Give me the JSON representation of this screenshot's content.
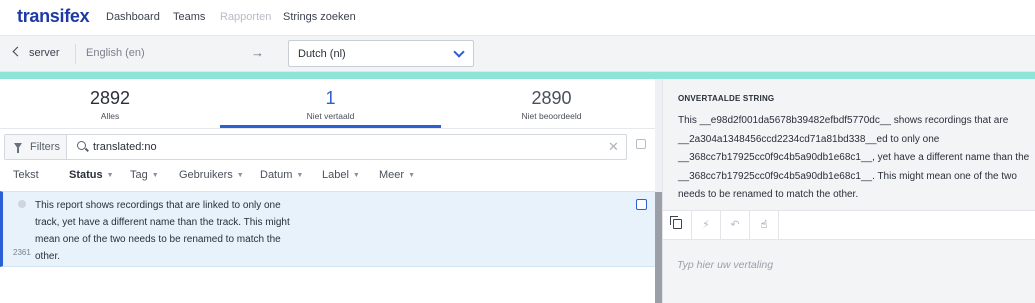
{
  "app": {
    "logo": "transifex"
  },
  "nav": {
    "items": [
      {
        "label": "Dashboard",
        "enabled": true
      },
      {
        "label": "Teams",
        "enabled": true
      },
      {
        "label": "Rapporten",
        "enabled": false
      },
      {
        "label": "Strings zoeken",
        "enabled": true
      }
    ]
  },
  "subbar": {
    "back_label": "server",
    "source_language": "English (en)",
    "arrow": "→",
    "target_language": "Dutch (nl)"
  },
  "stats": [
    {
      "count": "2892",
      "label": "Alles"
    },
    {
      "count": "1",
      "label": "Niet vertaald"
    },
    {
      "count": "2890",
      "label": "Niet beoordeeld"
    }
  ],
  "filters": {
    "button_label": "Filters",
    "query": "translated:no",
    "clear_glyph": "✕",
    "tabs": [
      {
        "label": "Tekst",
        "bold": false,
        "dropdown": false
      },
      {
        "label": "Status",
        "bold": true,
        "dropdown": true
      },
      {
        "label": "Tag",
        "bold": false,
        "dropdown": true
      },
      {
        "label": "Gebruikers",
        "bold": false,
        "dropdown": true
      },
      {
        "label": "Datum",
        "bold": false,
        "dropdown": true
      },
      {
        "label": "Label",
        "bold": false,
        "dropdown": true
      },
      {
        "label": "Meer",
        "bold": false,
        "dropdown": true
      }
    ]
  },
  "strings": [
    {
      "id": "2361",
      "text": "This report shows recordings that are linked to only one track, yet have a different name than the track. This might mean one of the two needs to be renamed to match the other."
    }
  ],
  "panel": {
    "heading": "ONVERTAALDE STRING",
    "source_text": "This __e98d2f001da5678b39482efbdf5770dc__ shows recordings that are __2a304a1348456ccd2234cd71a81bd338__ed to only one __368cc7b17925cc0f9c4b5a90db1e68c1__, yet have a different name than the __368cc7b17925cc0f9c4b5a90db1e68c1__. This might mean one of the two needs to be renamed to match the other.",
    "tools": [
      {
        "name": "copy-source-icon",
        "glyph": "",
        "enabled": true
      },
      {
        "name": "lightning-icon",
        "glyph": "⚡",
        "enabled": false
      },
      {
        "name": "undo-icon",
        "glyph": "↶",
        "enabled": false
      },
      {
        "name": "hand-icon",
        "glyph": "☝",
        "enabled": true
      }
    ],
    "translation_placeholder": "Typ hier uw vertaling"
  },
  "colors": {
    "brand": "#1f3aa6",
    "accent": "#2b5fd6",
    "teal_bar": "#8fe4d8",
    "row_highlight": "#e7f2fb"
  }
}
